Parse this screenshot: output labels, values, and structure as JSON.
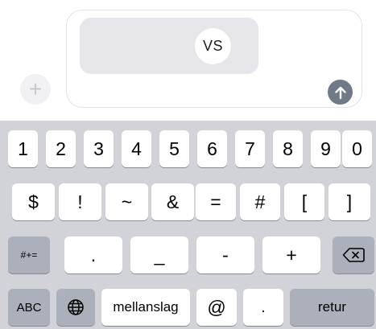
{
  "compose": {
    "plus_label": "+",
    "preview_badge": "VS"
  },
  "keyboard": {
    "row1": [
      "1",
      "2",
      "3",
      "4",
      "5",
      "6",
      "7",
      "8",
      "9",
      "0"
    ],
    "row2": [
      "$",
      "!",
      "~",
      "&",
      "=",
      "#",
      "[",
      "]"
    ],
    "row3": {
      "mode_key": "#+=",
      "keys": [
        ".",
        "_",
        "-",
        "+"
      ],
      "delete_icon": "delete-backspace-icon"
    },
    "row4": {
      "abc_key": "ABC",
      "globe_icon": "globe-icon",
      "space_key": "mellanslag",
      "at_key": "@",
      "dot_key": ".",
      "return_key": "retur"
    }
  }
}
